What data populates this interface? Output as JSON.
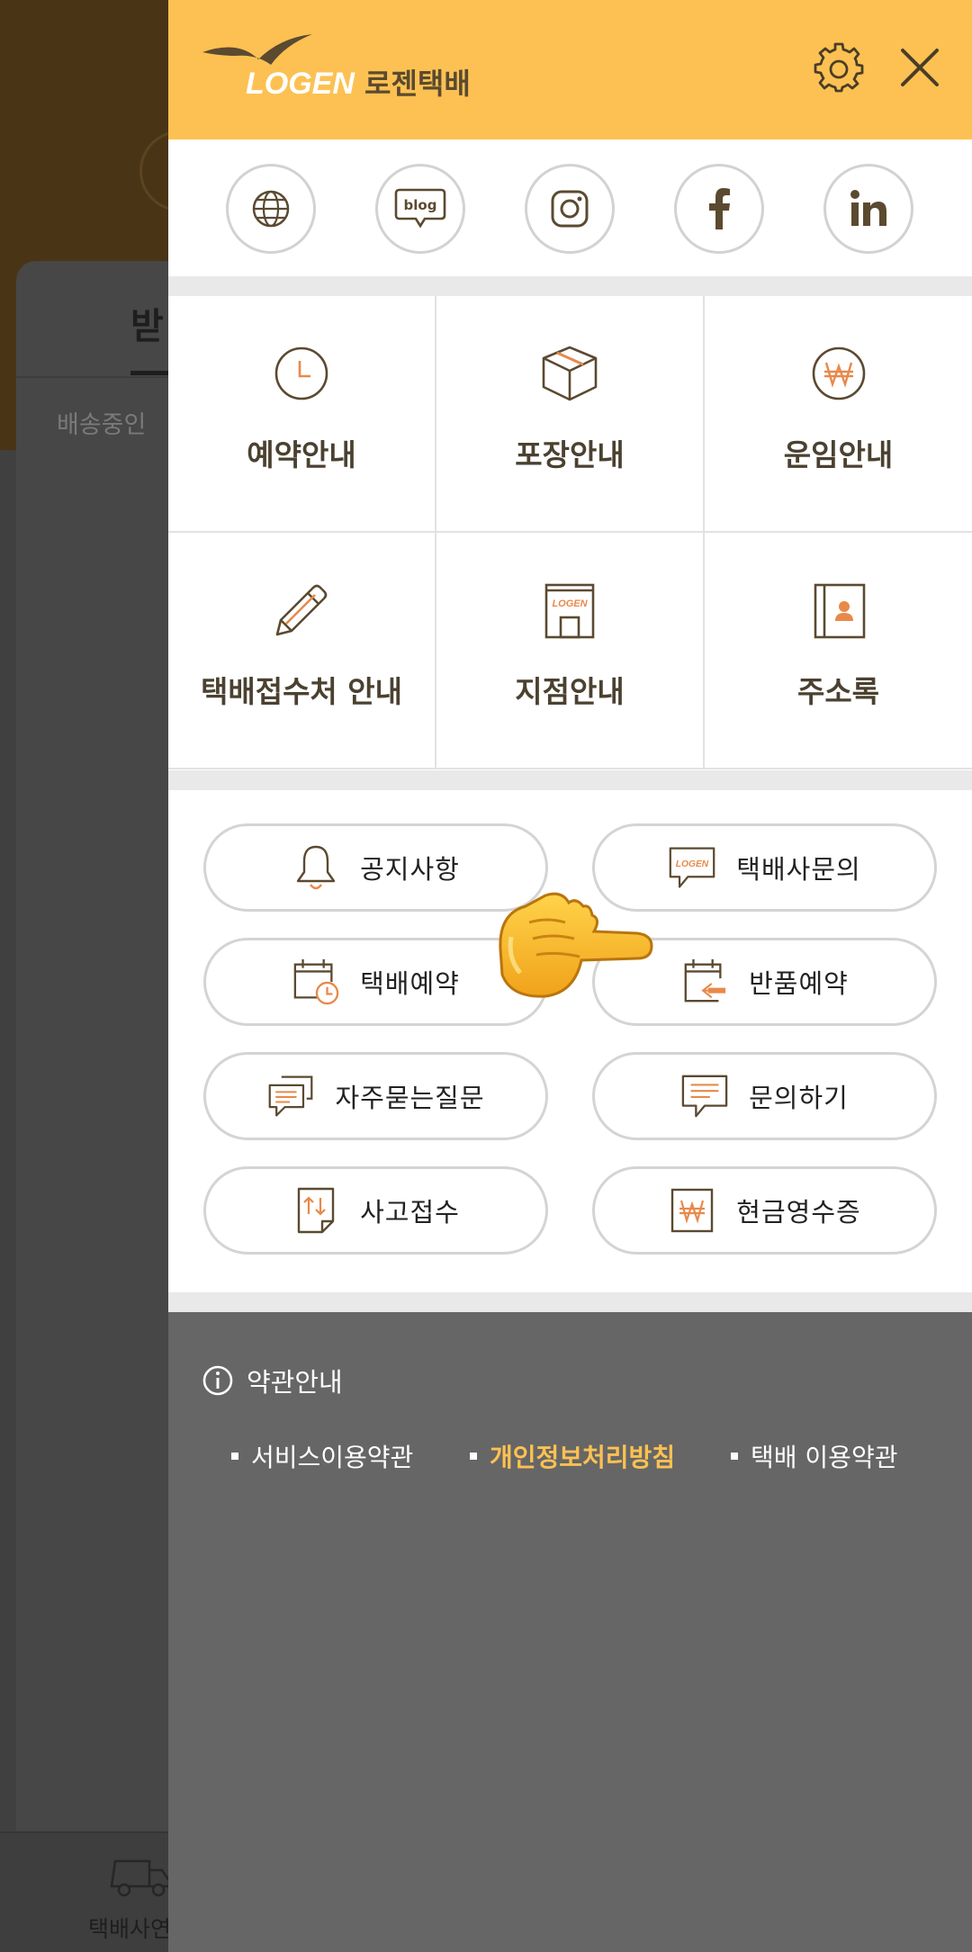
{
  "background": {
    "tab_partial": "받",
    "status_partial": "배송중인",
    "bottom_nav_label": "택배사연"
  },
  "header": {
    "logo_text": "LOGEN",
    "logo_korean": "로젠택배",
    "settings_icon": "gear-icon",
    "close_icon": "close-icon"
  },
  "social": [
    {
      "name": "website",
      "icon": "globe-icon"
    },
    {
      "name": "blog",
      "icon": "blog-icon",
      "text": "blog"
    },
    {
      "name": "instagram",
      "icon": "instagram-icon"
    },
    {
      "name": "facebook",
      "icon": "facebook-icon"
    },
    {
      "name": "linkedin",
      "icon": "linkedin-icon"
    }
  ],
  "grid": [
    {
      "label": "예약안내",
      "icon": "clock-icon"
    },
    {
      "label": "포장안내",
      "icon": "box-icon"
    },
    {
      "label": "운임안내",
      "icon": "won-coin-icon"
    },
    {
      "label": "택배접수처 안내",
      "icon": "pencil-icon"
    },
    {
      "label": "지점안내",
      "icon": "store-icon",
      "icon_text": "LOGEN"
    },
    {
      "label": "주소록",
      "icon": "address-book-icon"
    }
  ],
  "pills": [
    {
      "label": "공지사항",
      "icon": "bell-icon"
    },
    {
      "label": "택배사문의",
      "icon": "logen-chat-icon",
      "icon_text": "LOGEN"
    },
    {
      "label": "택배예약",
      "icon": "calendar-clock-icon"
    },
    {
      "label": "반품예약",
      "icon": "calendar-return-icon"
    },
    {
      "label": "자주묻는질문",
      "icon": "faq-chat-icon"
    },
    {
      "label": "문의하기",
      "icon": "inquiry-chat-icon"
    },
    {
      "label": "사고접수",
      "icon": "accident-doc-icon"
    },
    {
      "label": "현금영수증",
      "icon": "cash-receipt-icon"
    }
  ],
  "terms": {
    "title": "약관안내",
    "links": [
      {
        "label": "서비스이용약관"
      },
      {
        "label": "개인정보처리방침"
      },
      {
        "label": "택배 이용약관"
      }
    ]
  },
  "colors": {
    "brand_yellow": "#fcc152",
    "icon_brown": "#5b4a30",
    "icon_orange": "#e8894a",
    "terms_bg": "#666666"
  }
}
